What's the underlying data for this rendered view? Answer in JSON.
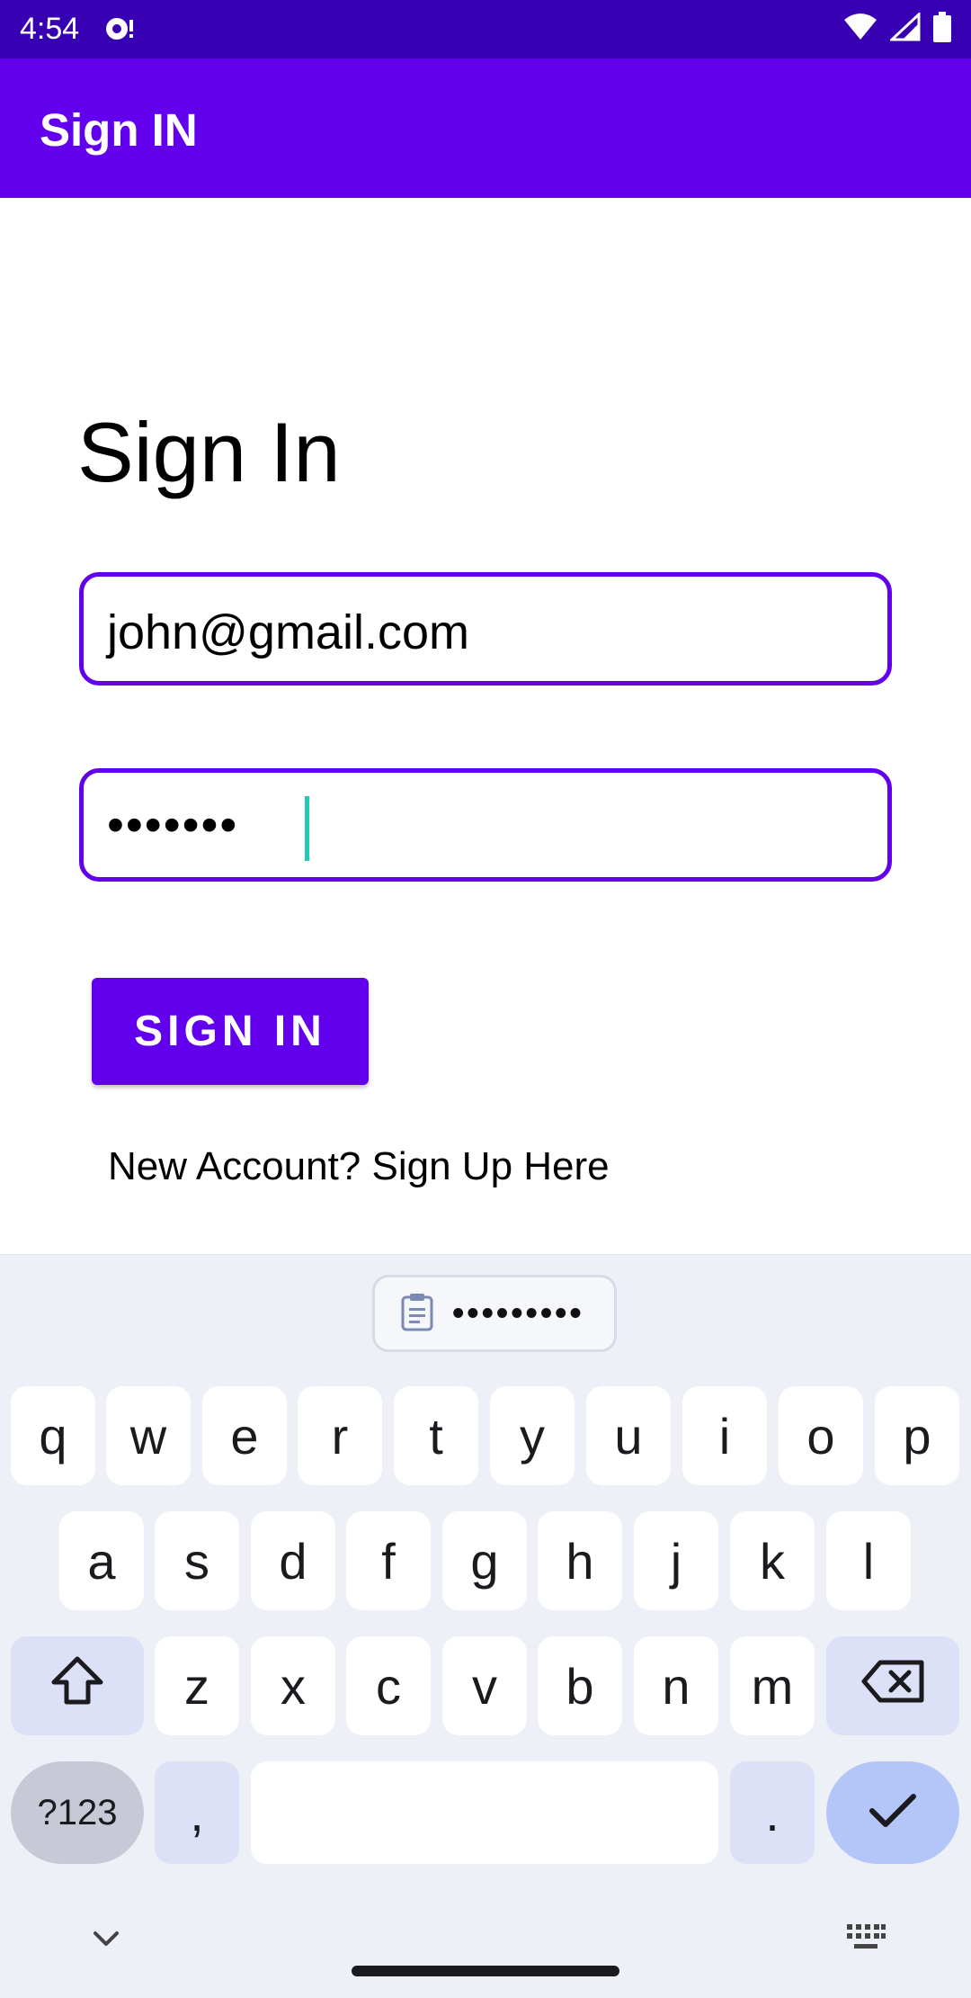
{
  "status_bar": {
    "time": "4:54",
    "icons": [
      "notification-icon",
      "wifi-icon",
      "signal-icon",
      "battery-icon"
    ]
  },
  "app_bar": {
    "title": "Sign IN"
  },
  "form": {
    "heading": "Sign In",
    "email_value": "john@gmail.com",
    "password_value": "•••••••",
    "signin_label": "SIGN IN",
    "signup_link": "New Account? Sign Up Here"
  },
  "keyboard": {
    "clipboard_suggestion": "•••••••••",
    "rows": [
      [
        "q",
        "w",
        "e",
        "r",
        "t",
        "y",
        "u",
        "i",
        "o",
        "p"
      ],
      [
        "a",
        "s",
        "d",
        "f",
        "g",
        "h",
        "j",
        "k",
        "l"
      ],
      [
        "z",
        "x",
        "c",
        "v",
        "b",
        "n",
        "m"
      ]
    ],
    "symbols_label": "?123",
    "comma_label": ",",
    "period_label": ".",
    "icons": [
      "shift-icon",
      "backspace-icon",
      "checkmark-icon",
      "chevron-down-icon",
      "keyboard-icon",
      "clipboard-icon"
    ]
  },
  "colors": {
    "primary": "#6200ee",
    "primary_dark": "#3700b3",
    "caret": "#1ecbb6",
    "keyboard_bg": "#eef0f7"
  }
}
